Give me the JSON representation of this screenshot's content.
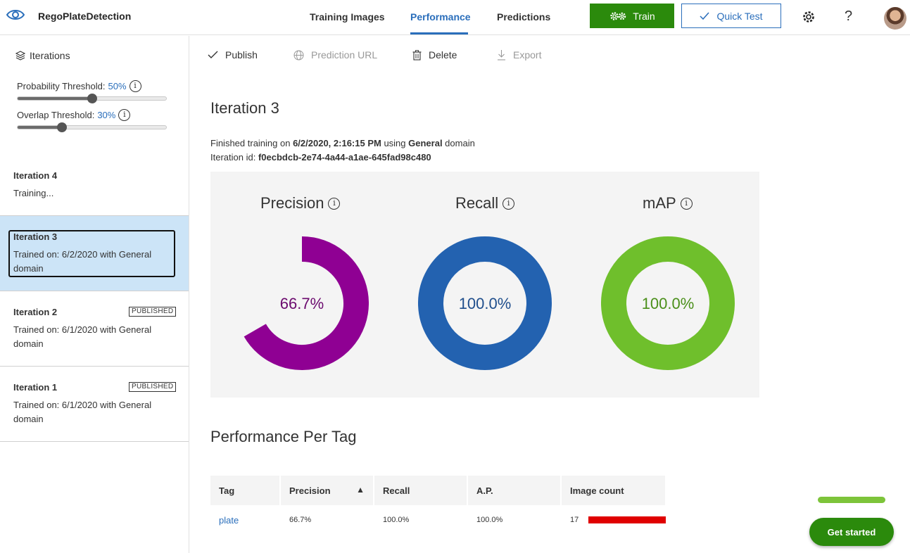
{
  "app": {
    "name": "RegoPlateDetection",
    "accent": "#2a6ebb",
    "train_color": "#2b8a0c"
  },
  "nav": {
    "tabs": [
      "Training Images",
      "Performance",
      "Predictions"
    ],
    "active_tab": "Performance",
    "train_label": "Train",
    "quicktest_label": "Quick Test",
    "help_label": "?"
  },
  "sidebar": {
    "header": "Iterations",
    "probability": {
      "label": "Probability Threshold:",
      "value": "50%",
      "level": 0.5
    },
    "overlap": {
      "label": "Overlap Threshold:",
      "value": "30%",
      "level": 0.3
    },
    "iterations": [
      {
        "title": "Iteration 4",
        "sub": "Training...",
        "badge": ""
      },
      {
        "title": "Iteration 3",
        "sub": "Trained on: 6/2/2020 with General domain",
        "badge": ""
      },
      {
        "title": "Iteration 2",
        "sub": "Trained on: 6/1/2020 with General domain",
        "badge": "PUBLISHED"
      },
      {
        "title": "Iteration 1",
        "sub": "Trained on: 6/1/2020 with General domain",
        "badge": "PUBLISHED"
      }
    ],
    "selected": "Iteration 3"
  },
  "toolbar": {
    "publish": "Publish",
    "prediction_url": "Prediction URL",
    "delete": "Delete",
    "export": "Export"
  },
  "iteration": {
    "title": "Iteration 3",
    "finished_prefix": "Finished training on ",
    "finished_date": "6/2/2020, 2:16:15 PM",
    "finished_using": " using ",
    "domain": "General",
    "domain_suffix": " domain",
    "id_label": "Iteration id: ",
    "id_value": "f0ecbdcb-2e74-4a44-a1ae-645fad98c480"
  },
  "metrics": [
    {
      "name": "Precision",
      "value": "66.7%",
      "fraction": 0.667,
      "color": "#8f0093",
      "text_color": "#6b0a6e"
    },
    {
      "name": "Recall",
      "value": "100.0%",
      "fraction": 1.0,
      "color": "#2362b0",
      "text_color": "#1f4e8c"
    },
    {
      "name": "mAP",
      "value": "100.0%",
      "fraction": 1.0,
      "color": "#6fbf2c",
      "text_color": "#4a8f1a"
    }
  ],
  "per_tag": {
    "title": "Performance Per Tag",
    "columns": [
      "Tag",
      "Precision",
      "Recall",
      "A.P.",
      "Image count"
    ],
    "rows": [
      {
        "tag": "plate",
        "precision": "66.7%",
        "recall": "100.0%",
        "ap": "100.0%",
        "image_count": "17"
      }
    ],
    "bar_color": "#e00000"
  },
  "get_started": {
    "label": "Get started",
    "progress": 1.0
  }
}
